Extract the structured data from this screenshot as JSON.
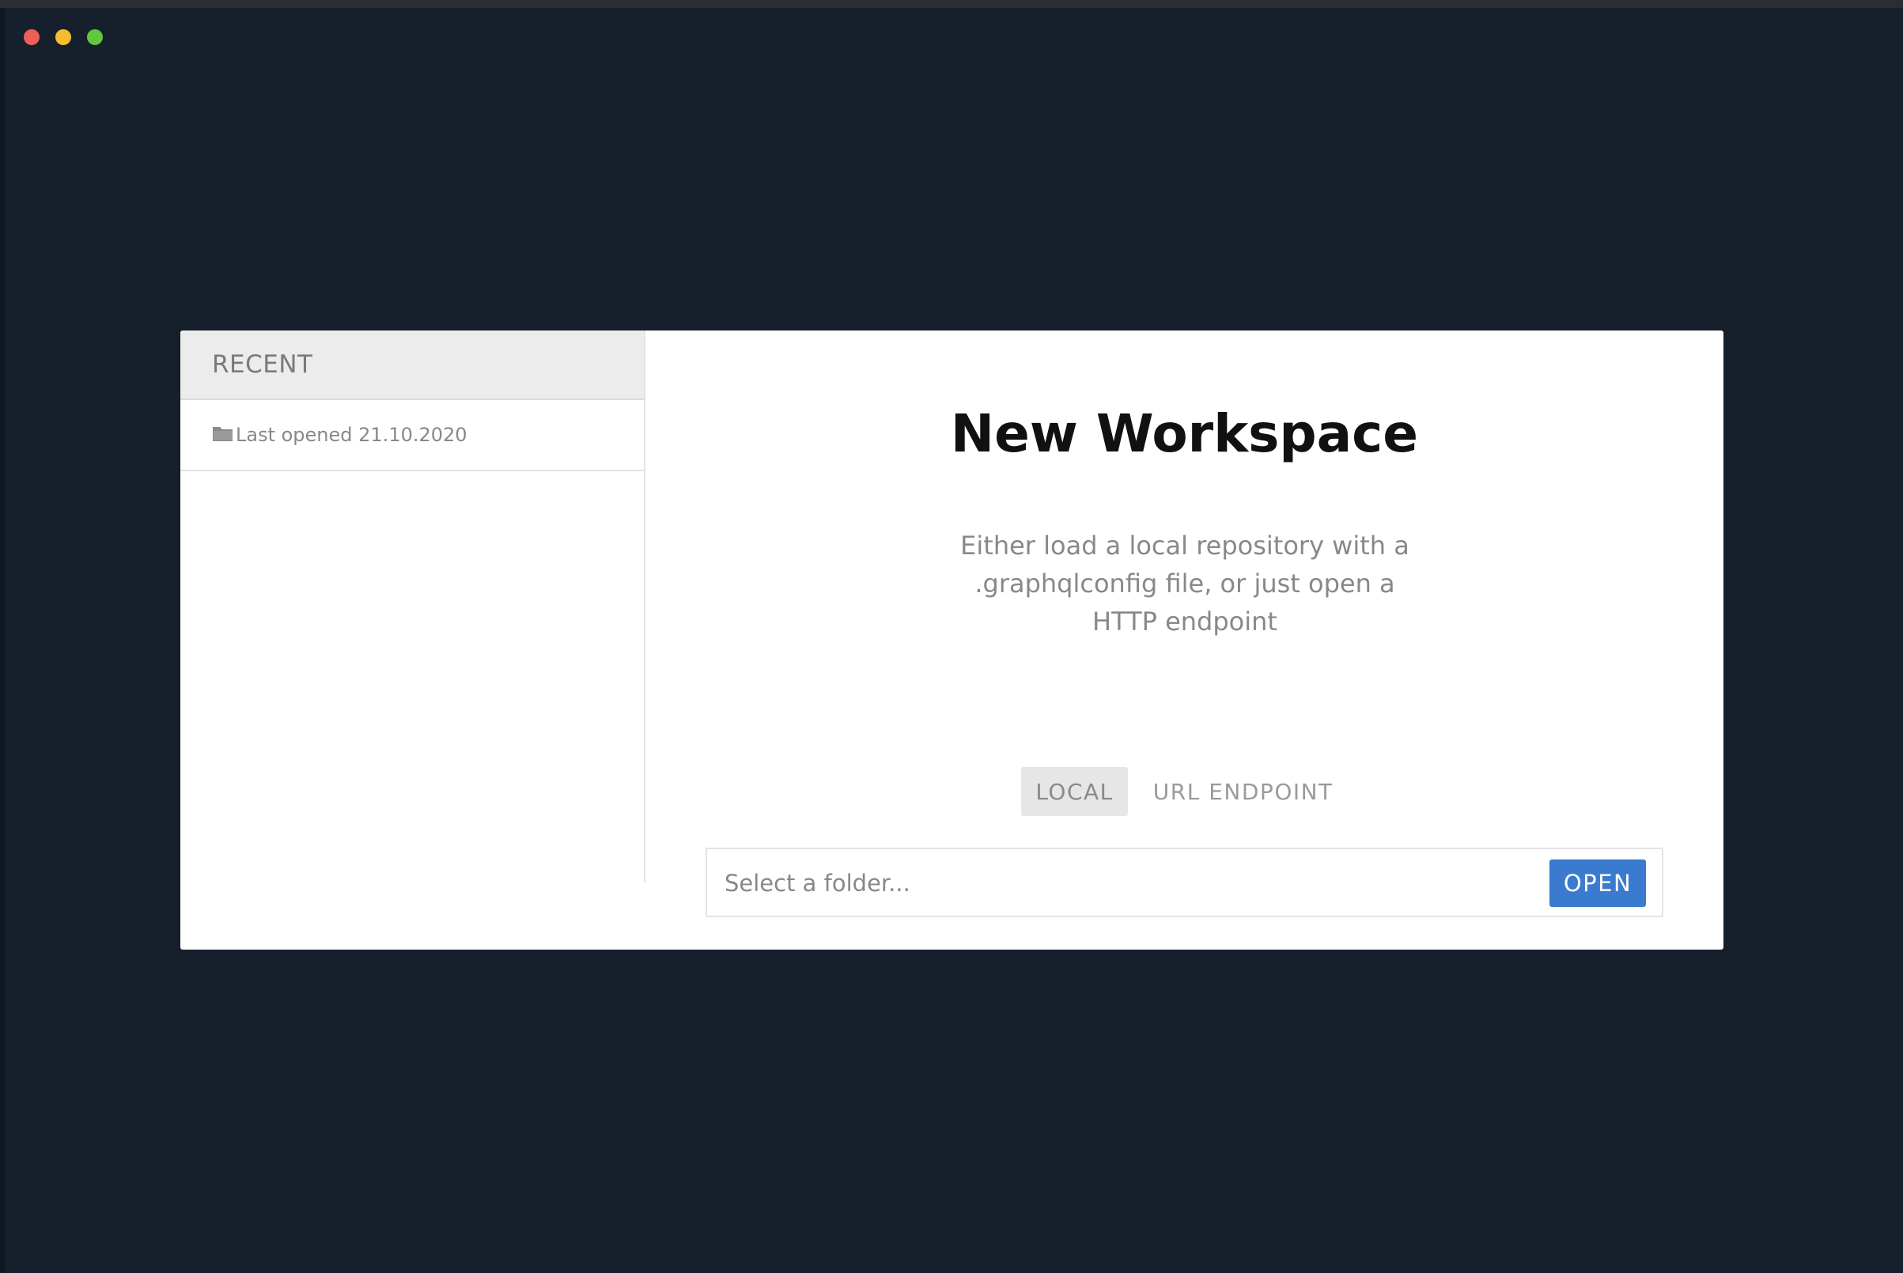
{
  "window": {
    "traffic_lights": {
      "close_color": "#ee5f57",
      "minimize_color": "#f5bd2f",
      "maximize_color": "#5fc83f"
    }
  },
  "sidebar": {
    "header": "RECENT",
    "items": [
      {
        "icon": "folder-icon",
        "label": "Last opened 21.10.2020"
      }
    ]
  },
  "main": {
    "title": "New Workspace",
    "description": "Either load a local repository with a .graphqlconfig file, or just open a HTTP endpoint",
    "tabs": [
      {
        "label": "LOCAL",
        "active": true
      },
      {
        "label": "URL ENDPOINT",
        "active": false
      }
    ],
    "folder_input": {
      "value": "",
      "placeholder": "Select a folder..."
    },
    "open_button_label": "OPEN",
    "accent_color": "#3a7bd0"
  }
}
